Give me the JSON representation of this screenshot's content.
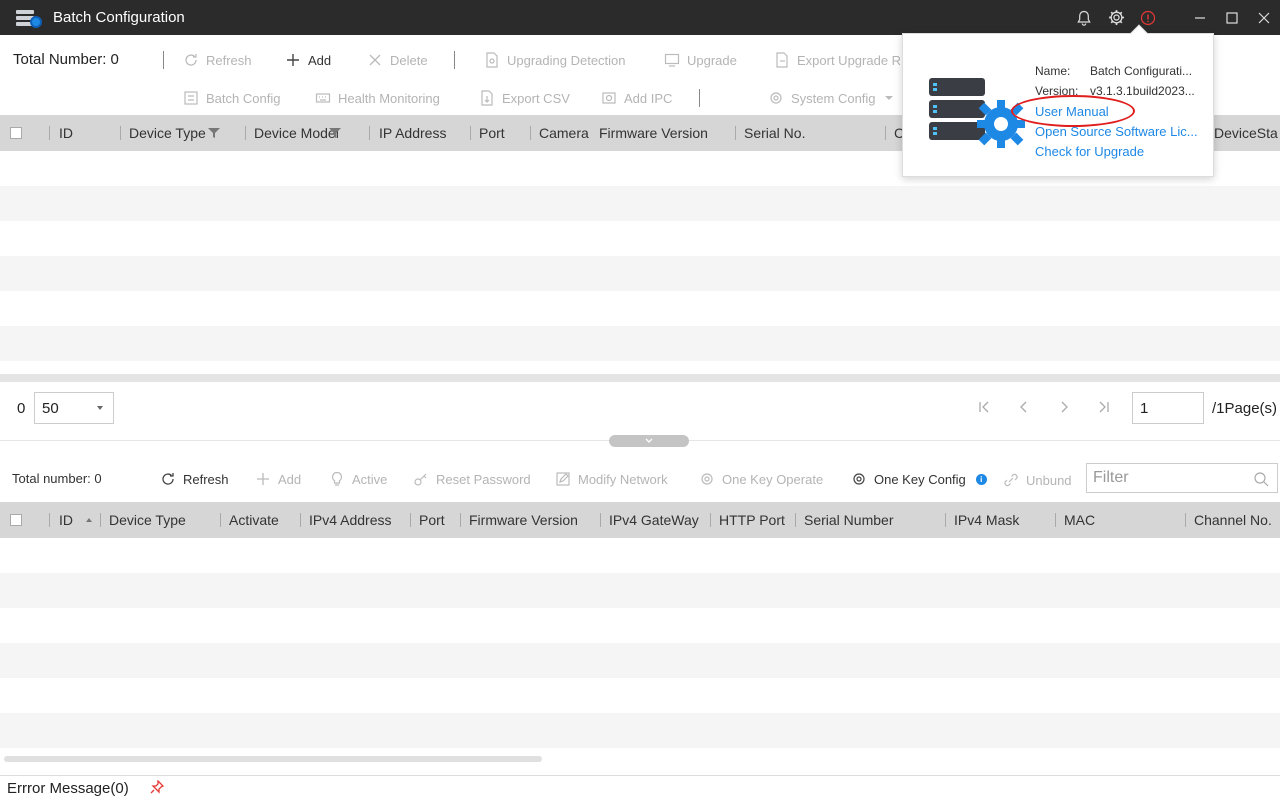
{
  "window": {
    "title": "Batch Configuration"
  },
  "top_toolbar": {
    "total_label": "Total Number: 0",
    "refresh": "Refresh",
    "add": "Add",
    "delete": "Delete",
    "upgrading_detection": "Upgrading Detection",
    "upgrade": "Upgrade",
    "export_upgrade": "Export Upgrade R",
    "batch_config": "Batch Config",
    "health_monitoring": "Health Monitoring",
    "export_csv": "Export CSV",
    "add_ipc": "Add IPC",
    "system_config": "System Config"
  },
  "top_table": {
    "columns": [
      "ID",
      "Device Type",
      "Device Model",
      "IP Address",
      "Port",
      "Camera",
      "Firmware Version",
      "Serial No.",
      "C",
      "DeviceSta"
    ]
  },
  "pager": {
    "count": "0",
    "page_size": "50",
    "page": "1",
    "page_total": "/1Page(s)"
  },
  "lower_toolbar": {
    "total_label": "Total number: 0",
    "refresh": "Refresh",
    "add": "Add",
    "active": "Active",
    "reset_password": "Reset Password",
    "modify_network": "Modify Network",
    "one_key_operate": "One Key Operate",
    "one_key_config": "One Key Config",
    "unbund": "Unbund",
    "filter_placeholder": "Filter"
  },
  "lower_table": {
    "columns": [
      "ID",
      "Device Type",
      "Activate",
      "IPv4 Address",
      "Port",
      "Firmware Version",
      "IPv4 GateWay",
      "HTTP Port",
      "Serial Number",
      "IPv4 Mask",
      "MAC",
      "Channel No."
    ]
  },
  "status": {
    "error_message": "Errror Message(0)"
  },
  "about_popup": {
    "name_label": "Name:",
    "name_value": "Batch Configurati...",
    "version_label": "Version:",
    "version_value": "v3.1.3.1build2023...",
    "user_manual": "User Manual",
    "open_source": "Open Source Software Lic...",
    "check_upgrade": "Check for Upgrade"
  },
  "colors": {
    "titlebar": "#2b2b2b",
    "header": "#d6d6d6",
    "link": "#1e88e5",
    "highlight": "#e01e1e"
  }
}
